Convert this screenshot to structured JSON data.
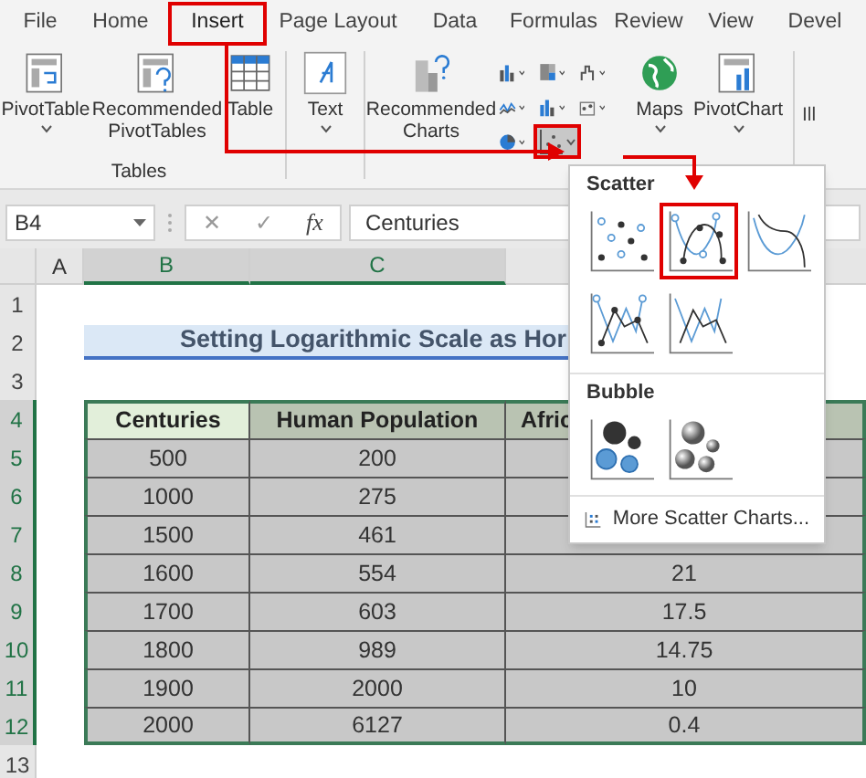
{
  "tabs": [
    {
      "label": "File",
      "selected": false
    },
    {
      "label": "Home",
      "selected": false
    },
    {
      "label": "Insert",
      "selected": true
    },
    {
      "label": "Page Layout",
      "selected": false
    },
    {
      "label": "Data",
      "selected": false
    },
    {
      "label": "Formulas",
      "selected": false
    },
    {
      "label": "Review",
      "selected": false
    },
    {
      "label": "View",
      "selected": false
    },
    {
      "label": "Devel",
      "selected": false
    }
  ],
  "ribbon": {
    "tables_group": {
      "label": "Tables",
      "buttons": [
        {
          "kind": "pivot",
          "label": "PivotTable",
          "dropdown": true
        },
        {
          "kind": "rec-pivot",
          "label": "Recommended PivotTables",
          "dropdown": false
        },
        {
          "kind": "table",
          "label": "Table",
          "dropdown": false
        }
      ]
    },
    "text_button": {
      "label": "Text",
      "dropdown": true
    },
    "recommended_charts": {
      "label": "Recommended Charts"
    },
    "chart_buttons": [
      {
        "kind": "column",
        "highlighted": false
      },
      {
        "kind": "hierarchy",
        "highlighted": false
      },
      {
        "kind": "waterfall",
        "highlighted": false
      },
      {
        "kind": "line",
        "highlighted": false
      },
      {
        "kind": "bar",
        "highlighted": false
      },
      {
        "kind": "combo",
        "highlighted": false
      },
      {
        "kind": "pie",
        "highlighted": false
      },
      {
        "kind": "scatter",
        "highlighted": true
      }
    ],
    "more_buttons": [
      {
        "kind": "maps",
        "label": "Maps",
        "dropdown": true
      },
      {
        "kind": "pivotchart",
        "label": "PivotChart",
        "dropdown": true
      }
    ],
    "cut_group": "Ill"
  },
  "formula_bar": {
    "name_box": "B4",
    "cancel": "✕",
    "enter": "✓",
    "fx": "fx",
    "formula": "Centuries"
  },
  "columns": [
    {
      "label": "A",
      "selected": false
    },
    {
      "label": "B",
      "selected": true
    },
    {
      "label": "C",
      "selected": true
    }
  ],
  "row_numbers": [
    {
      "label": "1",
      "selected": false
    },
    {
      "label": "2",
      "selected": false
    },
    {
      "label": "3",
      "selected": false
    },
    {
      "label": "4",
      "selected": true
    },
    {
      "label": "5",
      "selected": true
    },
    {
      "label": "6",
      "selected": true
    },
    {
      "label": "7",
      "selected": true
    },
    {
      "label": "8",
      "selected": true
    },
    {
      "label": "9",
      "selected": true
    },
    {
      "label": "10",
      "selected": true
    },
    {
      "label": "11",
      "selected": true
    },
    {
      "label": "12",
      "selected": true
    },
    {
      "label": "13",
      "selected": false
    }
  ],
  "title": "Setting Logarithmic Scale as Hor",
  "table": {
    "columns": [
      "Centuries",
      "Human Population",
      "Afric"
    ],
    "rows": [
      [
        "500",
        "200"
      ],
      [
        "1000",
        "275"
      ],
      [
        "1500",
        "461"
      ],
      [
        "1600",
        "554",
        "21"
      ],
      [
        "1700",
        "603",
        "17.5"
      ],
      [
        "1800",
        "989",
        "14.75"
      ],
      [
        "1900",
        "2000",
        "10"
      ],
      [
        "2000",
        "6127",
        "0.4"
      ]
    ]
  },
  "menu": {
    "sections": [
      {
        "title": "Scatter",
        "charts": [
          {
            "kind": "markers",
            "selected": false
          },
          {
            "kind": "smooth-markers",
            "selected": true
          },
          {
            "kind": "smooth",
            "selected": false
          },
          {
            "kind": "straight-markers",
            "selected": false
          },
          {
            "kind": "straight",
            "selected": false
          }
        ]
      },
      {
        "title": "Bubble",
        "charts": [
          {
            "kind": "bubble",
            "selected": false
          },
          {
            "kind": "bubble-3d",
            "selected": false
          }
        ]
      }
    ],
    "footer": "More Scatter Charts..."
  }
}
